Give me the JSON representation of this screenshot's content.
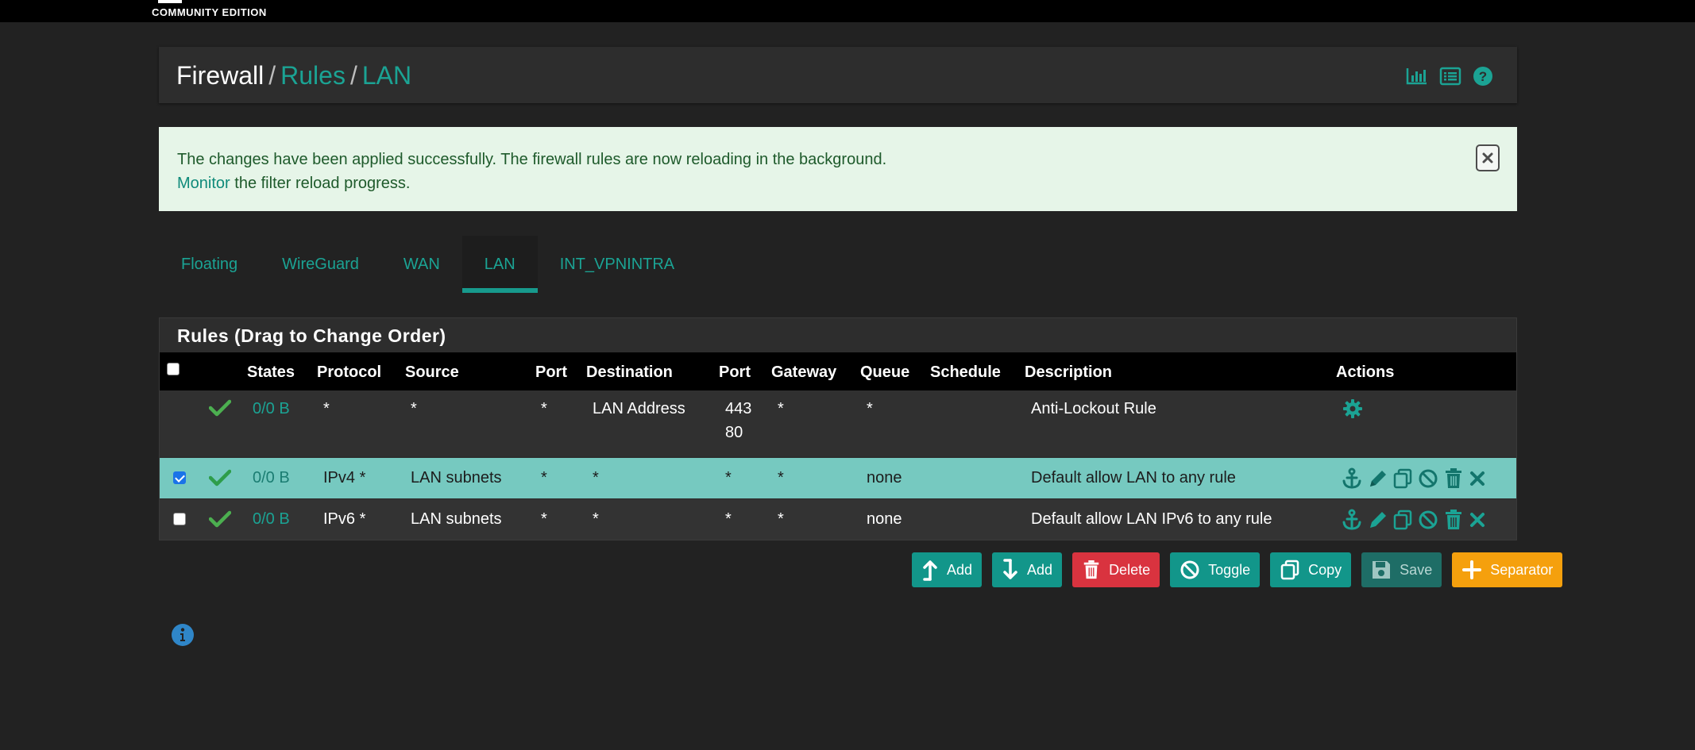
{
  "brand": {
    "edition": "COMMUNITY EDITION"
  },
  "header": {
    "breadcrumb": [
      "Firewall",
      "Rules",
      "LAN"
    ],
    "separator": "/",
    "icons": [
      "bar-chart-icon",
      "list-icon",
      "help-icon"
    ]
  },
  "alert": {
    "line1": "The changes have been applied successfully. The firewall rules are now reloading in the background.",
    "link": "Monitor",
    "line2_rest": " the filter reload progress.",
    "colors": {
      "background": "#e6f5e8",
      "text": "#1e5a2b"
    }
  },
  "tabs": [
    {
      "label": "Floating",
      "active": false
    },
    {
      "label": "WireGuard",
      "active": false
    },
    {
      "label": "WAN",
      "active": false
    },
    {
      "label": "LAN",
      "active": true
    },
    {
      "label": "INT_VPNINTRA",
      "active": false
    }
  ],
  "rules_table": {
    "title": "Rules (Drag to Change Order)",
    "columns": [
      "States",
      "Protocol",
      "Source",
      "Port",
      "Destination",
      "Port",
      "Gateway",
      "Queue",
      "Schedule",
      "Description",
      "Actions"
    ],
    "rows": [
      {
        "checkbox": false,
        "status": "pass",
        "states": "0/0 B",
        "protocol": "*",
        "source": "*",
        "source_port": "*",
        "destination": "LAN Address",
        "dest_port_1": "443",
        "dest_port_2": "80",
        "gateway": "*",
        "queue": "*",
        "schedule": "",
        "description": "Anti-Lockout Rule",
        "actions": [
          "gear-icon"
        ]
      },
      {
        "checkbox": true,
        "status": "pass",
        "states": "0/0 B",
        "protocol": "IPv4 *",
        "source": "LAN subnets",
        "source_port": "*",
        "destination": "*",
        "dest_port": "*",
        "gateway": "*",
        "queue": "none",
        "schedule": "",
        "description": "Default allow LAN to any rule",
        "selected": true,
        "actions": [
          "anchor-icon",
          "pencil-icon",
          "copy-icon",
          "disable-icon",
          "trash-icon",
          "times-icon"
        ]
      },
      {
        "checkbox": false,
        "status": "pass",
        "states": "0/0 B",
        "protocol": "IPv6 *",
        "source": "LAN subnets",
        "source_port": "*",
        "destination": "*",
        "dest_port": "*",
        "gateway": "*",
        "queue": "none",
        "schedule": "",
        "description": "Default allow LAN IPv6 to any rule",
        "actions": [
          "anchor-icon",
          "pencil-icon",
          "copy-icon",
          "disable-icon",
          "trash-icon",
          "times-icon"
        ]
      }
    ]
  },
  "buttons": {
    "add_top": "Add",
    "add_bottom": "Add",
    "delete": "Delete",
    "toggle": "Toggle",
    "copy": "Copy",
    "save": "Save",
    "separator": "Separator"
  },
  "colors": {
    "accent": "#1ba394",
    "delete": "#d9333f",
    "separator": "#f5a00d",
    "pass": "#4caf50"
  }
}
